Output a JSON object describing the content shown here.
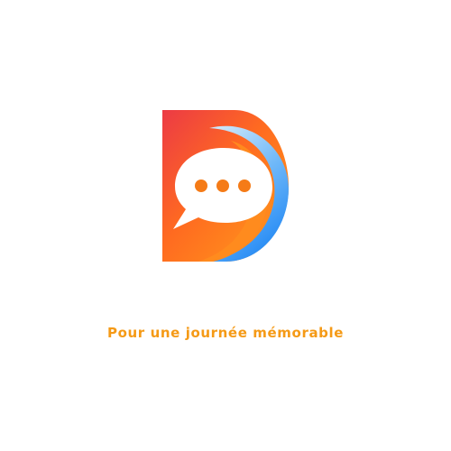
{
  "brand": {
    "logo_icon": "letter-d-chat-bubble-icon",
    "tagline": "Pour une journée mémorable"
  },
  "colors": {
    "tagline": "#f59a16",
    "logo_red": "#ec3a45",
    "logo_orange": "#ff7a1a",
    "logo_yellow_orange": "#ff9d1b",
    "logo_blue": "#2b97f6",
    "logo_light_blue": "#cbe5fb",
    "chat_dots": "#f57b17",
    "bubble": "#ffffff"
  }
}
